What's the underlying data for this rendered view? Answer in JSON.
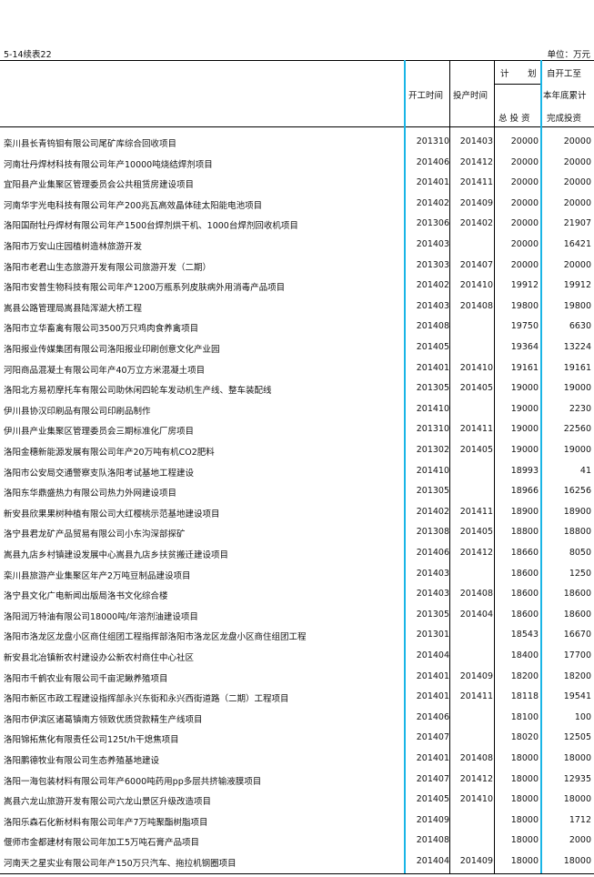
{
  "header": {
    "table_id": "5-14续表22",
    "unit": "单位：万元"
  },
  "columns": {
    "start_time": "开工时间",
    "end_time": "投产时间",
    "plan_top_left": "计",
    "plan_top_right": "划",
    "plan_total": "总 投 资",
    "cum_line1": "自开工至",
    "cum_line2": "本年底累计",
    "cum_line3": "完成投资"
  },
  "rows": [
    {
      "name": "栾川县长青钨钼有限公司尾矿库综合回收项目",
      "start": "201310",
      "end": "201403",
      "total": "20000",
      "done": "20000"
    },
    {
      "name": "河南壮丹焊材科技有限公司年产10000吨烧结焊剂项目",
      "start": "201406",
      "end": "201412",
      "total": "20000",
      "done": "20000"
    },
    {
      "name": "宜阳县产业集聚区管理委员会公共租赁房建设项目",
      "start": "201401",
      "end": "201411",
      "total": "20000",
      "done": "20000"
    },
    {
      "name": "河南华宇光电科技有限公司年产200兆瓦高效晶体硅太阳能电池项目",
      "start": "201402",
      "end": "201409",
      "total": "20000",
      "done": "20000"
    },
    {
      "name": "洛阳国耐牡丹焊材有限公司年产1500台焊剂烘干机、1000台焊剂回收机项目",
      "start": "201306",
      "end": "201402",
      "total": "20000",
      "done": "21907"
    },
    {
      "name": "洛阳市万安山庄园植树造林旅游开发",
      "start": "201403",
      "end": "",
      "total": "20000",
      "done": "16421"
    },
    {
      "name": "洛阳市老君山生态旅游开发有限公司旅游开发（二期）",
      "start": "201303",
      "end": "201407",
      "total": "20000",
      "done": "20000"
    },
    {
      "name": "洛阳市安普生物科技有限公司年产1200万瓶系列皮肤病外用消毒产品项目",
      "start": "201402",
      "end": "201410",
      "total": "19912",
      "done": "19912"
    },
    {
      "name": "嵩县公路管理局嵩县陆浑湖大桥工程",
      "start": "201403",
      "end": "201408",
      "total": "19800",
      "done": "19800"
    },
    {
      "name": "洛阳市立华畜禽有限公司3500万只鸡肉食养禽项目",
      "start": "201408",
      "end": "",
      "total": "19750",
      "done": "6630"
    },
    {
      "name": "洛阳报业传媒集团有限公司洛阳报业印刷创意文化产业园",
      "start": "201405",
      "end": "",
      "total": "19364",
      "done": "13224"
    },
    {
      "name": "河阳商品混凝土有限公司年产40万立方米混凝土项目",
      "start": "201401",
      "end": "201410",
      "total": "19161",
      "done": "19161"
    },
    {
      "name": "洛阳北方易初摩托车有限公司助休闲四轮车发动机生产线、整车装配线",
      "start": "201305",
      "end": "201405",
      "total": "19000",
      "done": "19000"
    },
    {
      "name": "伊川县协汉印刷品有限公司印刷品制作",
      "start": "201410",
      "end": "",
      "total": "19000",
      "done": "2230"
    },
    {
      "name": "伊川县产业集聚区管理委员会三期标准化厂房项目",
      "start": "201310",
      "end": "201411",
      "total": "19000",
      "done": "22560"
    },
    {
      "name": "洛阳金穗新能源发展有限公司年产20万吨有机CO2肥料",
      "start": "201302",
      "end": "201405",
      "total": "19000",
      "done": "19000"
    },
    {
      "name": "洛阳市公安局交通警察支队洛阳考试基地工程建设",
      "start": "201410",
      "end": "",
      "total": "18993",
      "done": "41"
    },
    {
      "name": "洛阳东华鼎盛热力有限公司热力外网建设项目",
      "start": "201305",
      "end": "",
      "total": "18966",
      "done": "16256"
    },
    {
      "name": "新安县欣果果树种植有限公司大红樱桃示范基地建设项目",
      "start": "201402",
      "end": "201411",
      "total": "18900",
      "done": "18900"
    },
    {
      "name": "洛宁县君龙矿产品贸易有限公司小东沟深部探矿",
      "start": "201308",
      "end": "201405",
      "total": "18800",
      "done": "18800"
    },
    {
      "name": "嵩县九店乡村镇建设发展中心嵩县九店乡扶贫搬迁建设项目",
      "start": "201406",
      "end": "201412",
      "total": "18660",
      "done": "8050"
    },
    {
      "name": "栾川县旅游产业集聚区年产2万吨豆制品建设项目",
      "start": "201403",
      "end": "",
      "total": "18600",
      "done": "1250"
    },
    {
      "name": "洛宁县文化广电新闻出版局洛书文化综合楼",
      "start": "201403",
      "end": "201408",
      "total": "18600",
      "done": "18600"
    },
    {
      "name": "洛阳润万特油有限公司18000吨/年溶剂油建设项目",
      "start": "201305",
      "end": "201404",
      "total": "18600",
      "done": "18600"
    },
    {
      "name": "洛阳市洛龙区龙盘小区商住组团工程指挥部洛阳市洛龙区龙盘小区商住组团工程",
      "start": "201301",
      "end": "",
      "total": "18543",
      "done": "16670"
    },
    {
      "name": "新安县北冶镇新农村建设办公新农村商住中心社区",
      "start": "201404",
      "end": "",
      "total": "18400",
      "done": "17700"
    },
    {
      "name": "洛阳市千鹤农业有限公司千亩泥鳅养殖项目",
      "start": "201401",
      "end": "201409",
      "total": "18200",
      "done": "18200"
    },
    {
      "name": "洛阳市新区市政工程建设指挥部永兴东街和永兴西街道路（二期）工程项目",
      "start": "201401",
      "end": "201411",
      "total": "18118",
      "done": "19541"
    },
    {
      "name": "洛阳市伊滨区诸葛镇南方领致优质贷款精生产线项目",
      "start": "201406",
      "end": "",
      "total": "18100",
      "done": "100"
    },
    {
      "name": "洛阳锦拓焦化有限责任公司125t/h干熄焦项目",
      "start": "201407",
      "end": "",
      "total": "18020",
      "done": "12505"
    },
    {
      "name": "洛阳鹏德牧业有限公司生态养殖基地建设",
      "start": "201401",
      "end": "201408",
      "total": "18000",
      "done": "18000"
    },
    {
      "name": "洛阳一海包装材料有限公司年产6000吨药用pp多层共挤输液膜项目",
      "start": "201407",
      "end": "201412",
      "total": "18000",
      "done": "12935"
    },
    {
      "name": "嵩县六龙山旅游开发有限公司六龙山景区升级改造项目",
      "start": "201405",
      "end": "201410",
      "total": "18000",
      "done": "18000"
    },
    {
      "name": "洛阳乐森石化新材料有限公司年产7万吨聚酯树脂项目",
      "start": "201409",
      "end": "",
      "total": "18000",
      "done": "1712"
    },
    {
      "name": "偃师市金都建材有限公司年加工5万吨石膏产品项目",
      "start": "201408",
      "end": "",
      "total": "18000",
      "done": "2000"
    },
    {
      "name": "河南天之星实业有限公司年产150万只汽车、拖拉机钢圈项目",
      "start": "201404",
      "end": "201409",
      "total": "18000",
      "done": "18000"
    }
  ]
}
